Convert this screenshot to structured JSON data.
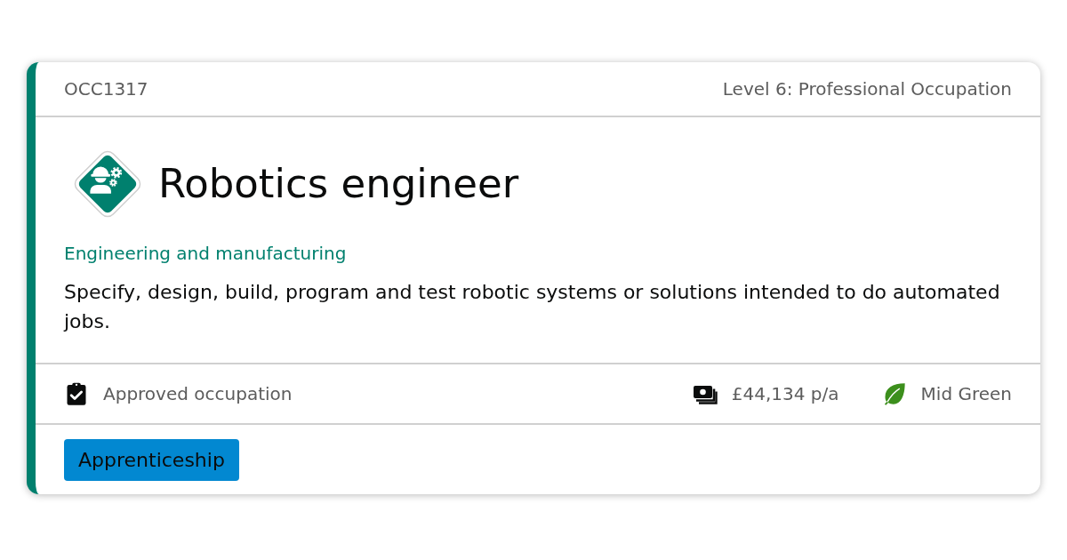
{
  "card": {
    "code": "OCC1317",
    "level": "Level 6: Professional Occupation",
    "title": "Robotics engineer",
    "route": "Engineering and manufacturing",
    "description": "Specify, design, build, program and test robotic systems or solutions intended to do automated jobs.",
    "details": [
      {
        "kind": "status",
        "text": "Approved occupation"
      },
      {
        "kind": "salary",
        "text": "£44,134 p/a"
      },
      {
        "kind": "green",
        "text": "Mid Green"
      }
    ],
    "tags": [
      {
        "label": "Apprenticeship"
      }
    ]
  }
}
